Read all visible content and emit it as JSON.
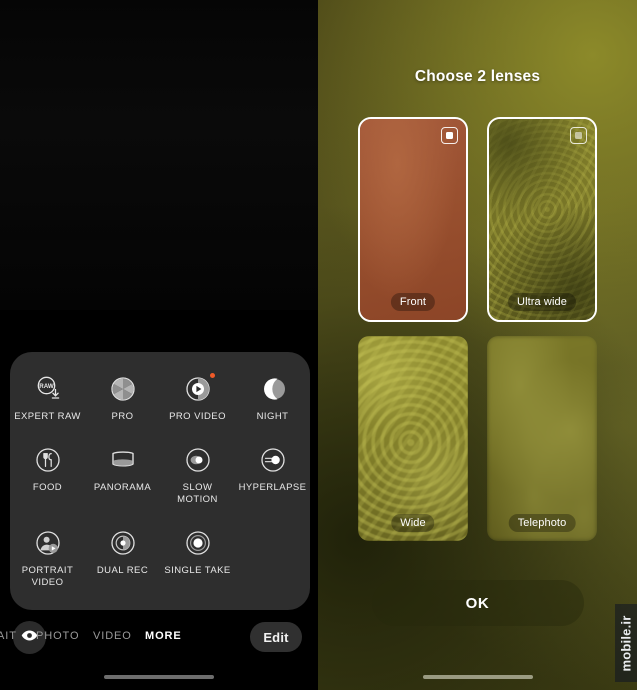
{
  "left": {
    "toolbar": {
      "eye_icon": "eye-icon",
      "edit_label": "Edit"
    },
    "modes": [
      {
        "label": "EXPERT RAW",
        "icon": "expert-raw-icon",
        "badge": false
      },
      {
        "label": "PRO",
        "icon": "aperture-icon",
        "badge": false
      },
      {
        "label": "PRO VIDEO",
        "icon": "pro-video-icon",
        "badge": true
      },
      {
        "label": "NIGHT",
        "icon": "moon-icon",
        "badge": false
      },
      {
        "label": "FOOD",
        "icon": "food-icon",
        "badge": false
      },
      {
        "label": "PANORAMA",
        "icon": "panorama-icon",
        "badge": false
      },
      {
        "label": "SLOW\nMOTION",
        "icon": "slow-motion-icon",
        "badge": false
      },
      {
        "label": "HYPERLAPSE",
        "icon": "hyperlapse-icon",
        "badge": false
      },
      {
        "label": "PORTRAIT\nVIDEO",
        "icon": "portrait-video-icon",
        "badge": false
      },
      {
        "label": "DUAL REC",
        "icon": "dual-rec-icon",
        "badge": false
      },
      {
        "label": "SINGLE TAKE",
        "icon": "single-take-icon",
        "badge": false
      }
    ],
    "tabs": [
      {
        "label": "AIT",
        "active": false
      },
      {
        "label": "PHOTO",
        "active": false
      },
      {
        "label": "VIDEO",
        "active": false
      },
      {
        "label": "MORE",
        "active": true
      }
    ]
  },
  "right": {
    "title": "Choose 2 lenses",
    "lenses": [
      {
        "name": "Front",
        "selected": true,
        "checkbox": "checkbox-checked"
      },
      {
        "name": "Ultra wide",
        "selected": true,
        "checkbox": "checkbox-checked-dim"
      },
      {
        "name": "Wide",
        "selected": false,
        "checkbox": ""
      },
      {
        "name": "Telephoto",
        "selected": false,
        "checkbox": ""
      }
    ],
    "ok_label": "OK",
    "watermark": "mobile.ir"
  },
  "colors": {
    "sheet_bg": "#2e2e2e",
    "badge_accent": "#f05a28",
    "right_bg": "#4b4718",
    "front_thumb": "#99502f",
    "selected_border": "#ffffff"
  }
}
